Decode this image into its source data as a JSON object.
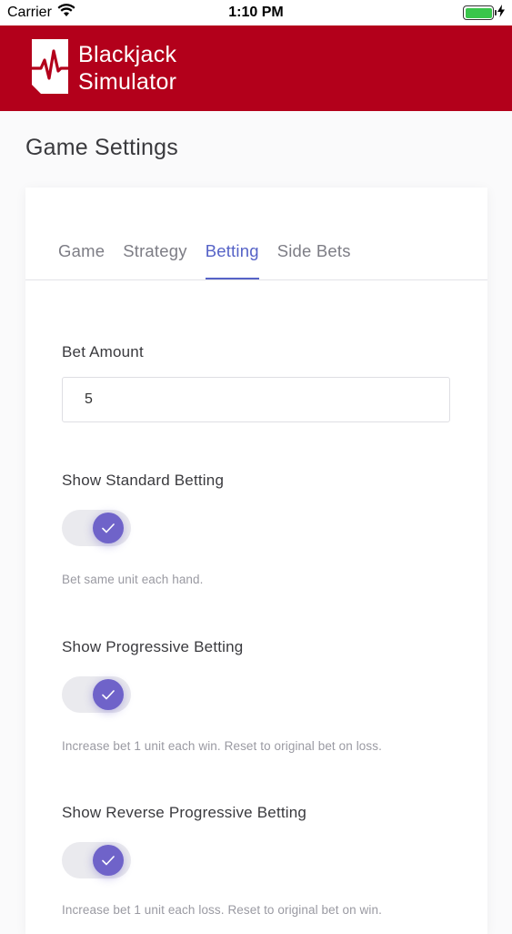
{
  "status_bar": {
    "carrier": "Carrier",
    "time": "1:10 PM"
  },
  "header": {
    "logo_line1": "Blackjack",
    "logo_line2": "Simulator",
    "brand_color": "#b3001b"
  },
  "page": {
    "title": "Game Settings"
  },
  "tabs": [
    {
      "label": "Game",
      "active": false
    },
    {
      "label": "Strategy",
      "active": false
    },
    {
      "label": "Betting",
      "active": true
    },
    {
      "label": "Side Bets",
      "active": false
    }
  ],
  "betting": {
    "bet_amount_label": "Bet Amount",
    "bet_amount_value": "5",
    "standard": {
      "label": "Show Standard Betting",
      "enabled": true,
      "help": "Bet same unit each hand."
    },
    "progressive": {
      "label": "Show Progressive Betting",
      "enabled": true,
      "help": "Increase bet 1 unit each win. Reset to original bet on loss."
    },
    "reverse_progressive": {
      "label": "Show Reverse Progressive Betting",
      "enabled": true,
      "help": "Increase bet 1 unit each loss. Reset to original bet on win."
    }
  },
  "colors": {
    "accent": "#5663c7",
    "toggle_on": "#6f63c9"
  }
}
